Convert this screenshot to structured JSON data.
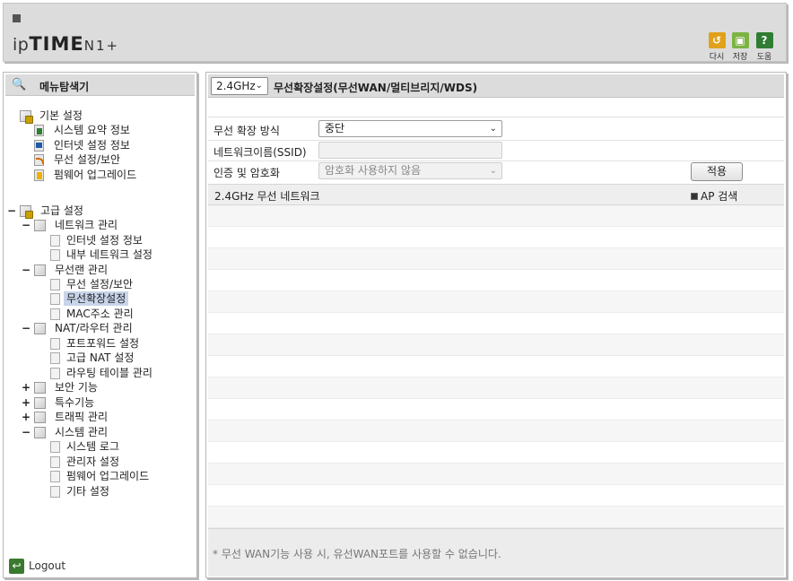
{
  "header": {
    "logo_prefix": "ip",
    "logo_brand": "TIME",
    "logo_model": "N1+",
    "buttons": [
      {
        "label": "다시",
        "icon": "undo-icon",
        "glyph": "↺",
        "color": "#e2a11a"
      },
      {
        "label": "저장",
        "icon": "save-icon",
        "glyph": "▣",
        "color": "#7cb342"
      },
      {
        "label": "도움",
        "icon": "help-icon",
        "glyph": "?",
        "color": "#2e7d32"
      }
    ]
  },
  "sidebar": {
    "title": "메뉴탐색기",
    "basic": {
      "label": "기본 설정",
      "items": [
        "시스템 요약 정보",
        "인터넷 설정 정보",
        "무선 설정/보안",
        "펌웨어 업그레이드"
      ]
    },
    "advanced": {
      "label": "고급 설정",
      "network": {
        "label": "네트워크 관리",
        "items": [
          "인터넷 설정 정보",
          "내부 네트워크 설정"
        ]
      },
      "wireless": {
        "label": "무선랜 관리",
        "items": [
          "무선 설정/보안",
          "무선확장설정",
          "MAC주소 관리"
        ]
      },
      "nat": {
        "label": "NAT/라우터 관리",
        "items": [
          "포트포워드 설정",
          "고급 NAT 설정",
          "라우팅 테이블 관리"
        ]
      },
      "security": {
        "label": "보안 기능"
      },
      "special": {
        "label": "특수기능"
      },
      "traffic": {
        "label": "트래픽 관리"
      },
      "system": {
        "label": "시스템 관리",
        "items": [
          "시스템 로그",
          "관리자 설정",
          "펌웨어 업그레이드",
          "기타 설정"
        ]
      }
    },
    "toggle_expanded": "−",
    "toggle_collapsed": "+",
    "logout": "Logout"
  },
  "main": {
    "band": "2.4GHz",
    "title": "무선확장설정(무선WAN/멀티브리지/WDS)",
    "mode_label": "무선 확장 방식",
    "mode_value": "중단",
    "ssid_label": "네트워크이름(SSID)",
    "ssid_value": "",
    "auth_label": "인증 및 암호화",
    "auth_value": "암호화 사용하지 않음",
    "apply": "적용",
    "list_title": "2.4GHz 무선 네트워크",
    "ap_scan": "AP 검색",
    "note": "* 무선 WAN기능 사용 시, 유선WAN포트를 사용할 수 없습니다."
  }
}
